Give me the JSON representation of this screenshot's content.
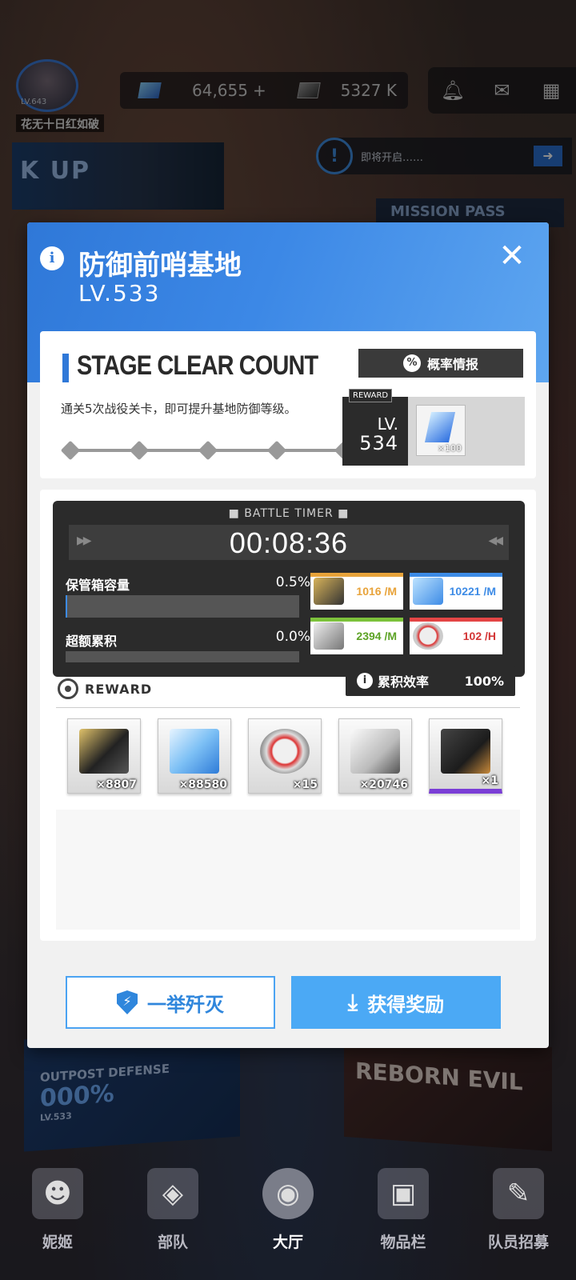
{
  "hud": {
    "player_level": "LV.643",
    "player_name": "花无十日红如破",
    "gems": "64,655",
    "gems_add": "+",
    "credits": "5327 K",
    "notice_text": "即将开启……",
    "banner_text": "K UP",
    "mission_pass": "MISSION PASS"
  },
  "modal": {
    "title": "防御前哨基地",
    "level": "LV.533",
    "close_label": "✕",
    "stage": {
      "heading": "STAGE CLEAR COUNT",
      "probability_button": "概率情报",
      "description": "通关5次战役关卡，即可提升基地防御等级。",
      "progress_completed": 5,
      "progress_total": 5,
      "reward_tag": "REWARD",
      "reward_lv_label": "LV.",
      "reward_lv_value": "534",
      "reward_item_qty": "×100"
    },
    "battle": {
      "timer_label": "BATTLE TIMER",
      "timer_value": "00:08:36",
      "storage_label": "保管箱容量",
      "storage_value": "0.5%",
      "overflow_label": "超额累积",
      "overflow_value": "0.0%",
      "rates": [
        {
          "name": "credit-card",
          "value": "1016 /M",
          "color": "#e8a33a"
        },
        {
          "name": "core-dust-usb",
          "value": "10221 /M",
          "color": "#3d8be6"
        },
        {
          "name": "battle-data",
          "value": "2394 /M",
          "color": "#7cc23b"
        },
        {
          "name": "gear-orb",
          "value": "102 /H",
          "color": "#e34545"
        }
      ],
      "efficiency_label": "累积效率",
      "efficiency_value": "100%"
    },
    "reward_section": {
      "label": "REWARD",
      "items": [
        {
          "name": "credit-card",
          "qty": "×8807"
        },
        {
          "name": "core-dust-usb",
          "qty": "×88580"
        },
        {
          "name": "gear-orb",
          "qty": "×15"
        },
        {
          "name": "battle-data",
          "qty": "×20746"
        },
        {
          "name": "equipment-case",
          "qty": "×1"
        }
      ]
    },
    "buttons": {
      "wipe_out": "一举歼灭",
      "claim": "获得奖励"
    }
  },
  "background": {
    "outpost_title": "OUTPOST DEFENSE",
    "outpost_pct": "000%",
    "outpost_level": "LV.533",
    "outpost_small_pct": "000%",
    "event_title": "REBORN EVIL"
  },
  "nav": [
    {
      "label": "妮姬",
      "icon": "nikke-icon",
      "active": false
    },
    {
      "label": "部队",
      "icon": "squad-icon",
      "active": false
    },
    {
      "label": "大厅",
      "icon": "lobby-icon",
      "active": true
    },
    {
      "label": "物品栏",
      "icon": "inventory-icon",
      "active": false
    },
    {
      "label": "队员招募",
      "icon": "recruit-icon",
      "active": false
    }
  ]
}
